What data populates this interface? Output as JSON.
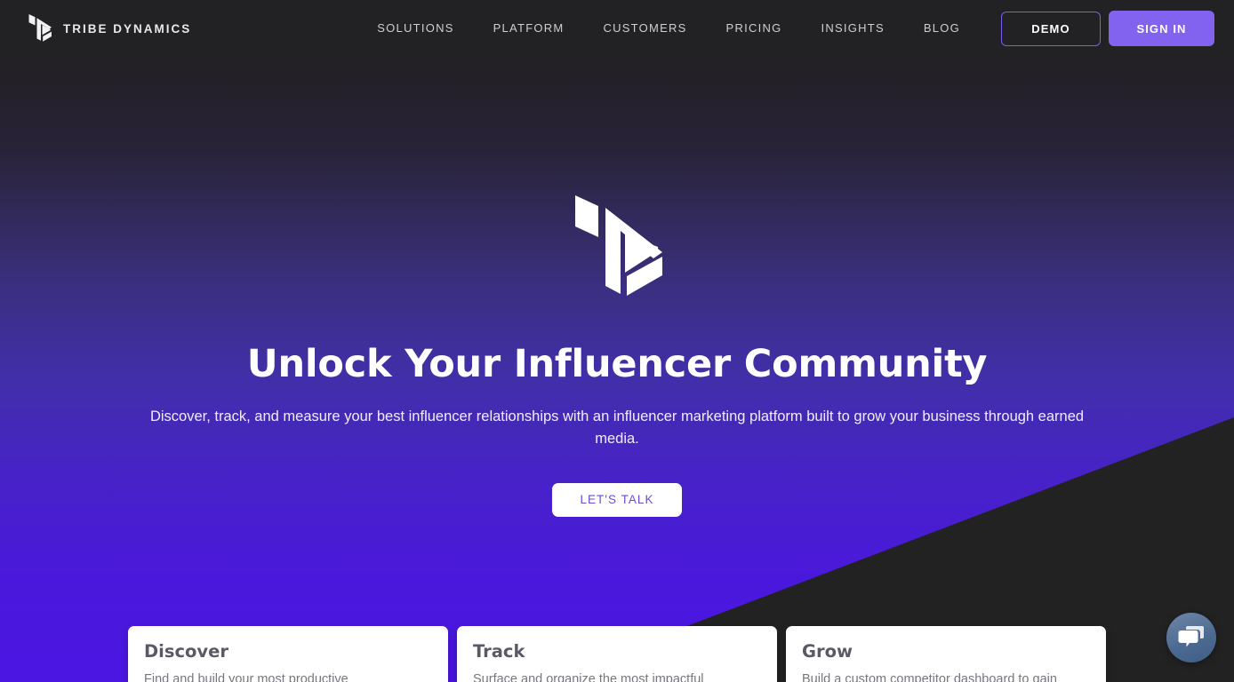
{
  "brand": {
    "name": "TRIBE DYNAMICS",
    "logo_icon": "tribe-dynamics-isometric-logo"
  },
  "nav": {
    "links": [
      {
        "label": "SOLUTIONS"
      },
      {
        "label": "PLATFORM"
      },
      {
        "label": "CUSTOMERS"
      },
      {
        "label": "PRICING"
      },
      {
        "label": "INSIGHTS"
      },
      {
        "label": "BLOG"
      }
    ],
    "demo_label": "DEMO",
    "signin_label": "SIGN IN",
    "bar_color": "#222124",
    "accent_color": "#8263ef",
    "demo_border_color": "#7d5cf0"
  },
  "hero": {
    "logo_icon": "tribe-dynamics-isometric-logo",
    "title": "Unlock Your Influencer Community",
    "subtitle": "Discover, track, and measure your best influencer relationships with an influencer marketing platform built to grow your business through earned media.",
    "cta_label": "LET'S TALK",
    "cta_text_color": "#6c4bd8",
    "gradient_top": "#222124",
    "gradient_bottom": "#4b16e2",
    "wedge_color": "#222222"
  },
  "cards": [
    {
      "title": "Discover",
      "body": "Find and build your most productive"
    },
    {
      "title": "Track",
      "body": "Surface and organize the most impactful"
    },
    {
      "title": "Grow",
      "body": "Build a custom competitor dashboard to gain"
    }
  ],
  "chat": {
    "icon": "chat-bubbles-icon",
    "color_start": "#6f86a8",
    "color_end": "#3e5d86"
  }
}
